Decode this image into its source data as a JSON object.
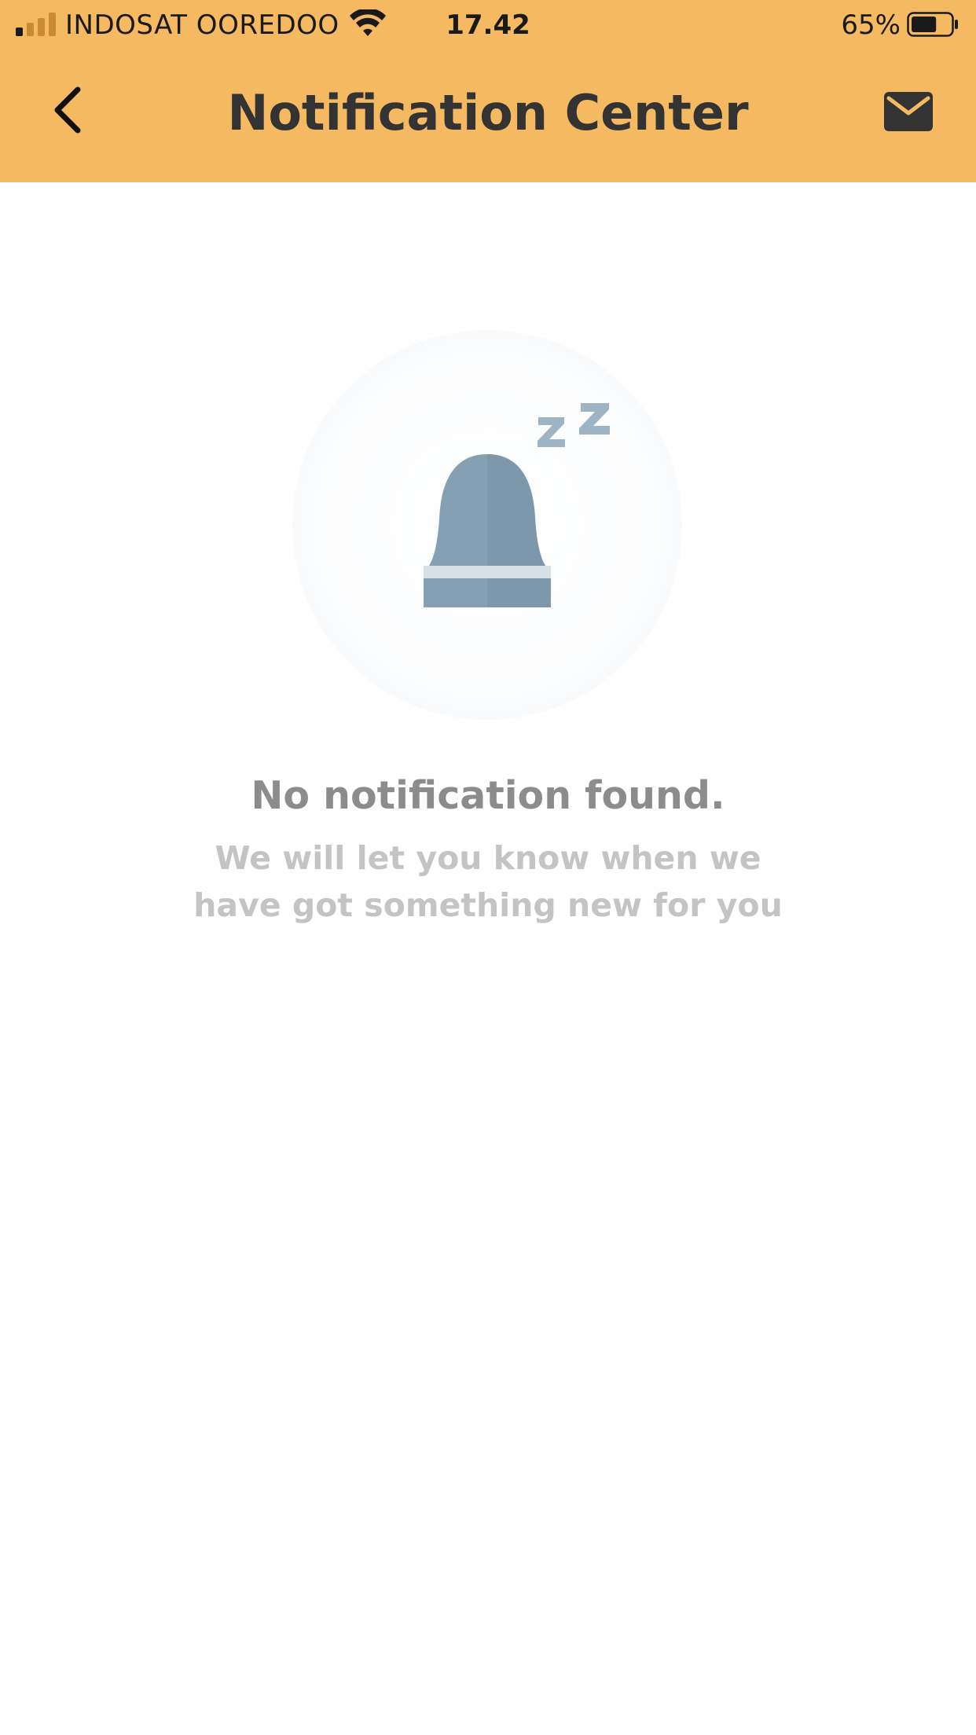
{
  "status_bar": {
    "carrier": "INDOSAT OOREDOO",
    "time": "17.42",
    "battery_percent": "65%",
    "signal_icon": "signal-bars-icon",
    "wifi_icon": "wifi-icon",
    "battery_icon": "battery-icon",
    "battery_level": 0.65
  },
  "header": {
    "title": "Notification Center",
    "back_icon": "chevron-left-icon",
    "mail_icon": "envelope-icon",
    "background_color": "#F5B961"
  },
  "empty_state": {
    "icon": "sleeping-bell-icon",
    "title": "No notification found.",
    "message": "We will let you know when we have got something new for you"
  }
}
